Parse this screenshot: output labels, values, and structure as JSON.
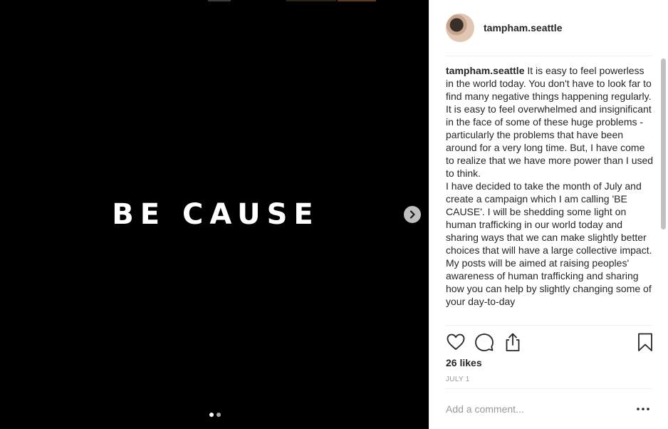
{
  "post": {
    "slide_text": "BE CAUSE",
    "slide_count": 2,
    "active_slide": 1
  },
  "header": {
    "username": "tampham.seattle"
  },
  "caption": {
    "username": "tampham.seattle",
    "paragraphs": [
      "It is easy to feel powerless in the world today. You don't have to look far to find many negative things happening regularly. It is easy to feel overwhelmed and insignificant in the face of some of these huge problems - particularly the problems that have been around for a very long time. But, I have come to realize that we have more power than I used to think.",
      "I have decided to take the month of July and create a campaign which I am calling 'BE CAUSE'. I will be shedding some light on human trafficking in our world today and sharing ways that we can make slightly better choices that will have a large collective impact.",
      "My posts will be aimed at raising peoples' awareness of human trafficking and sharing how you can help by slightly changing some of your day-to-day"
    ]
  },
  "actions": {
    "like_icon": "heart-icon",
    "comment_icon": "speech-bubble-icon",
    "share_icon": "share-icon",
    "save_icon": "bookmark-icon"
  },
  "stats": {
    "likes": "26 likes",
    "date": "JULY 1"
  },
  "comment_box": {
    "placeholder": "Add a comment...",
    "value": ""
  },
  "colors": {
    "media_background": "#000000",
    "text": "#262626",
    "muted": "#999999",
    "divider": "#efefef"
  }
}
